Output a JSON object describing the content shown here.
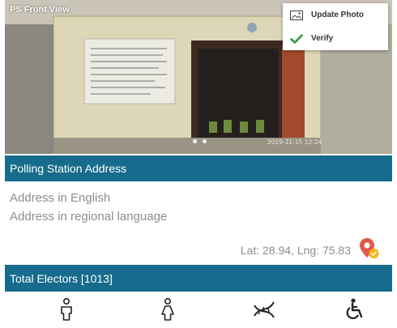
{
  "photo": {
    "label": "PS Front View",
    "timestamp": "2019-11-15 12:24",
    "carousel_pages": 2
  },
  "photo_menu": {
    "items": [
      {
        "label": "Update Photo",
        "icon": "image-icon"
      },
      {
        "label": "Verify",
        "icon": "checkmark-icon"
      }
    ]
  },
  "address_section": {
    "title": "Polling Station Address",
    "english_placeholder": "Address in English",
    "regional_placeholder": "Address in regional language",
    "coordinates": "Lat: 28.94, Lng: 75.83",
    "map_icon": "map-pin-icon"
  },
  "electors_section": {
    "title": "Total Electors [1013]",
    "categories": [
      {
        "icon": "male-icon"
      },
      {
        "icon": "female-icon"
      },
      {
        "icon": "third-gender-icon"
      },
      {
        "icon": "wheelchair-icon"
      }
    ]
  },
  "colors": {
    "header_bar": "#176b8c",
    "verify_check": "#2e9a3a",
    "map_pin": "#e2584a",
    "muted_text": "#8d8d8d"
  }
}
